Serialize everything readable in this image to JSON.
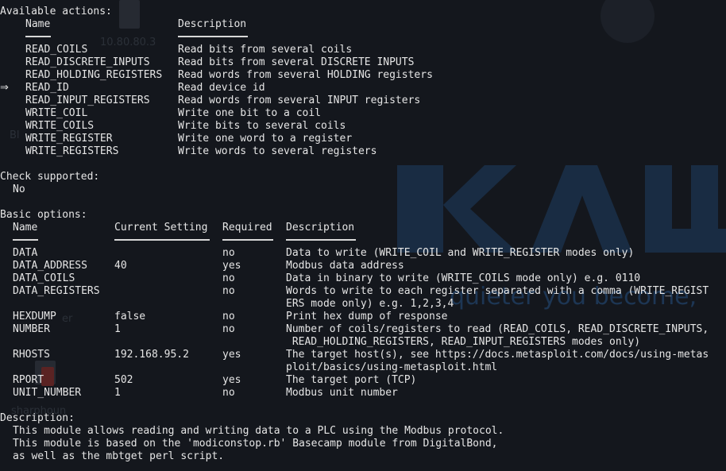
{
  "colors": {
    "background": "#14171d",
    "text": "#e6e6e6",
    "watermark": "#1c3653"
  },
  "background": {
    "logo": "KALI",
    "tagline": "quieter you become,",
    "desktop_labels": [
      "10.80.80.3",
      "Bl",
      "er",
      "sharphoun"
    ]
  },
  "actions": {
    "header": "Available actions:",
    "col_name": "Name",
    "col_description": "Description",
    "selected_marker": "⇒",
    "items": [
      {
        "name": "READ_COILS",
        "description": "Read bits from several coils"
      },
      {
        "name": "READ_DISCRETE_INPUTS",
        "description": "Read bits from several DISCRETE INPUTS"
      },
      {
        "name": "READ_HOLDING_REGISTERS",
        "description": "Read words from several HOLDING registers"
      },
      {
        "name": "READ_ID",
        "description": "Read device id"
      },
      {
        "name": "READ_INPUT_REGISTERS",
        "description": "Read words from several INPUT registers"
      },
      {
        "name": "WRITE_COIL",
        "description": "Write one bit to a coil"
      },
      {
        "name": "WRITE_COILS",
        "description": "Write bits to several coils"
      },
      {
        "name": "WRITE_REGISTER",
        "description": "Write one word to a register"
      },
      {
        "name": "WRITE_REGISTERS",
        "description": "Write words to several registers"
      }
    ]
  },
  "check": {
    "header": "Check supported:",
    "value": "No"
  },
  "options": {
    "header": "Basic options:",
    "col_name": "Name",
    "col_setting": "Current Setting",
    "col_required": "Required",
    "col_description": "Description",
    "rows": [
      {
        "name": "DATA",
        "setting": "",
        "required": "no",
        "description": [
          "Data to write (WRITE_COIL and WRITE_REGISTER modes only)"
        ]
      },
      {
        "name": "DATA_ADDRESS",
        "setting": "40",
        "required": "yes",
        "description": [
          "Modbus data address"
        ]
      },
      {
        "name": "DATA_COILS",
        "setting": "",
        "required": "no",
        "description": [
          "Data in binary to write (WRITE_COILS mode only) e.g. 0110"
        ]
      },
      {
        "name": "DATA_REGISTERS",
        "setting": "",
        "required": "no",
        "description": [
          "Words to write to each register separated with a comma (WRITE_REGIST",
          "ERS mode only) e.g. 1,2,3,4"
        ]
      },
      {
        "name": "HEXDUMP",
        "setting": "false",
        "required": "no",
        "description": [
          "Print hex dump of response"
        ]
      },
      {
        "name": "NUMBER",
        "setting": "1",
        "required": "no",
        "description": [
          "Number of coils/registers to read (READ_COILS, READ_DISCRETE_INPUTS,",
          " READ_HOLDING_REGISTERS, READ_INPUT_REGISTERS modes only)"
        ]
      },
      {
        "name": "RHOSTS",
        "setting": "192.168.95.2",
        "required": "yes",
        "description": [
          "The target host(s), see https://docs.metasploit.com/docs/using-metas",
          "ploit/basics/using-metasploit.html"
        ]
      },
      {
        "name": "RPORT",
        "setting": "502",
        "required": "yes",
        "description": [
          "The target port (TCP)"
        ]
      },
      {
        "name": "UNIT_NUMBER",
        "setting": "1",
        "required": "no",
        "description": [
          "Modbus unit number"
        ]
      }
    ]
  },
  "description": {
    "header": "Description:",
    "lines": [
      "This module allows reading and writing data to a PLC using the Modbus protocol.",
      "This module is based on the 'modiconstop.rb' Basecamp module from DigitalBond,",
      "as well as the mbtget perl script."
    ]
  }
}
